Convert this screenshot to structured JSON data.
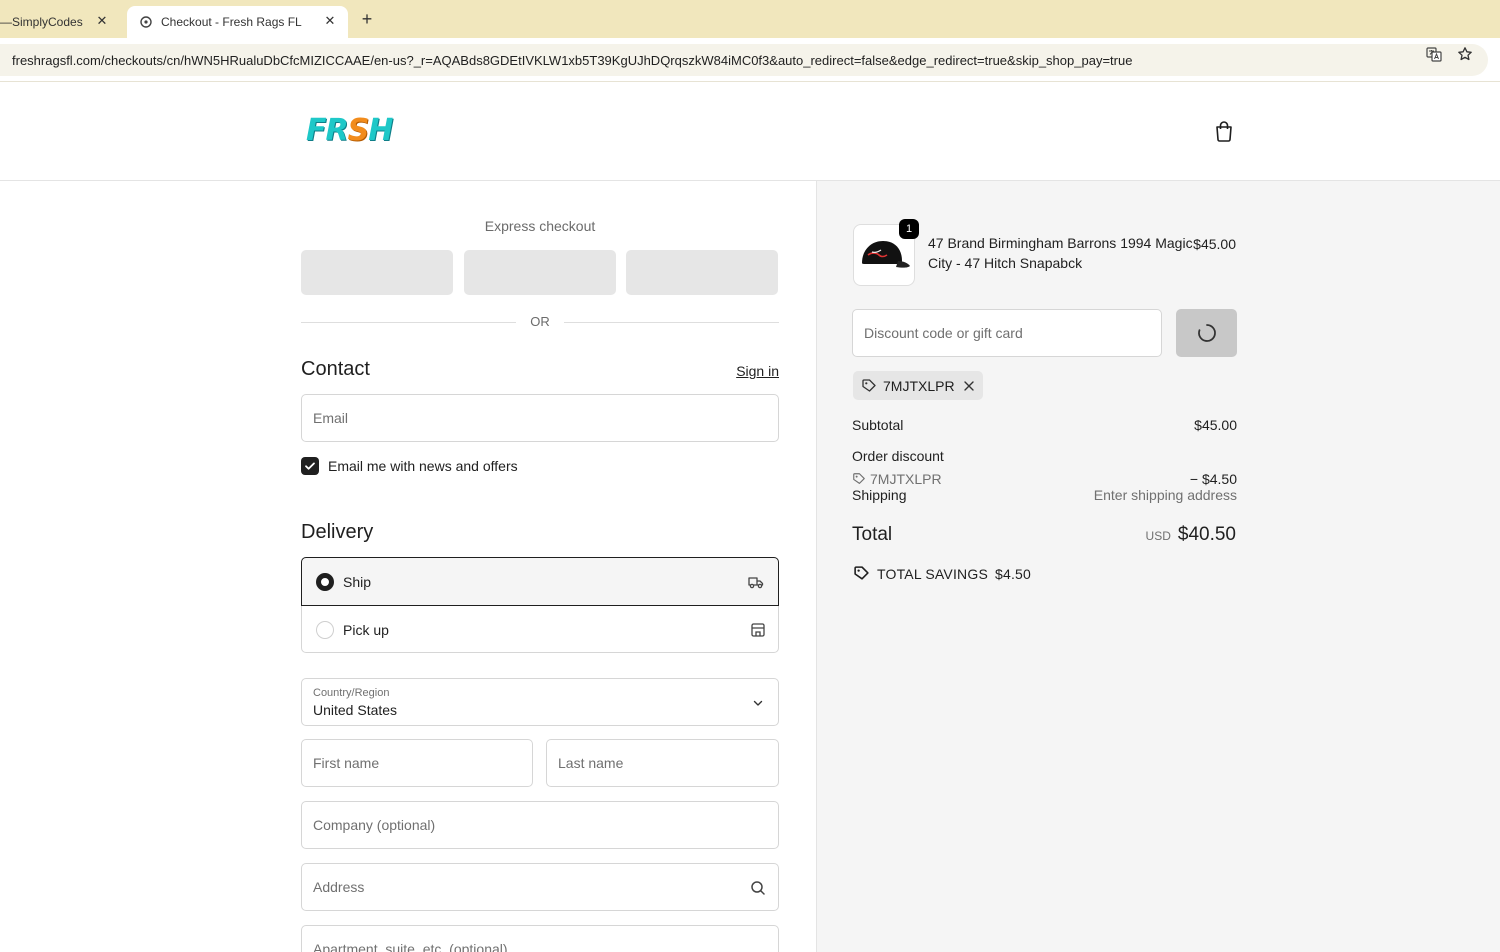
{
  "browser": {
    "tabs": [
      {
        "title": "SimplyCodes",
        "title_prefix": "— "
      },
      {
        "title": "Checkout - Fresh Rags FL"
      }
    ],
    "new_tab": "+",
    "close": "✕",
    "url": "freshragsfl.com/checkouts/cn/hWN5HRualuDbCfcMIZICCAAE/en-us?_r=AQABds8GDEtIVKLW1xb5T39KgUJhDQrqszkW84iMC0f3&auto_redirect=false&edge_redirect=true&skip_shop_pay=true"
  },
  "header": {
    "logo_part1": "FR",
    "logo_part2": "S",
    "logo_part3": "H"
  },
  "express": {
    "label": "Express checkout",
    "or": "OR"
  },
  "contact": {
    "title": "Contact",
    "sign_in": "Sign in",
    "email_placeholder": "Email",
    "newsletter_label": "Email me with news and offers",
    "newsletter_checked": true
  },
  "delivery": {
    "title": "Delivery",
    "options": [
      {
        "label": "Ship",
        "selected": true
      },
      {
        "label": "Pick up",
        "selected": false
      }
    ],
    "country_label": "Country/Region",
    "country_value": "United States",
    "first_name_placeholder": "First name",
    "last_name_placeholder": "Last name",
    "company_placeholder": "Company (optional)",
    "address_placeholder": "Address",
    "apartment_placeholder": "Apartment, suite, etc. (optional)"
  },
  "summary": {
    "product": {
      "name": "47 Brand Birmingham Barrons 1994 Magic City - 47 Hitch Snapabck",
      "price": "$45.00",
      "quantity": "1"
    },
    "discount_placeholder": "Discount code or gift card",
    "applied_code": "7MJTXLPR",
    "subtotal_label": "Subtotal",
    "subtotal_value": "$45.00",
    "order_discount_label": "Order discount",
    "discount_code": "7MJTXLPR",
    "discount_value": "− $4.50",
    "shipping_label": "Shipping",
    "shipping_value": "Enter shipping address",
    "total_label": "Total",
    "currency": "USD",
    "total_value": "$40.50",
    "savings_label": "TOTAL SAVINGS",
    "savings_value": "$4.50"
  },
  "colors": {
    "accent_dark": "#1f1f1f",
    "logo_teal": "#1ec8c8",
    "logo_orange": "#f28c1c",
    "tabbar": "#f1e7bd",
    "summary_bg": "#f5f5f5"
  }
}
